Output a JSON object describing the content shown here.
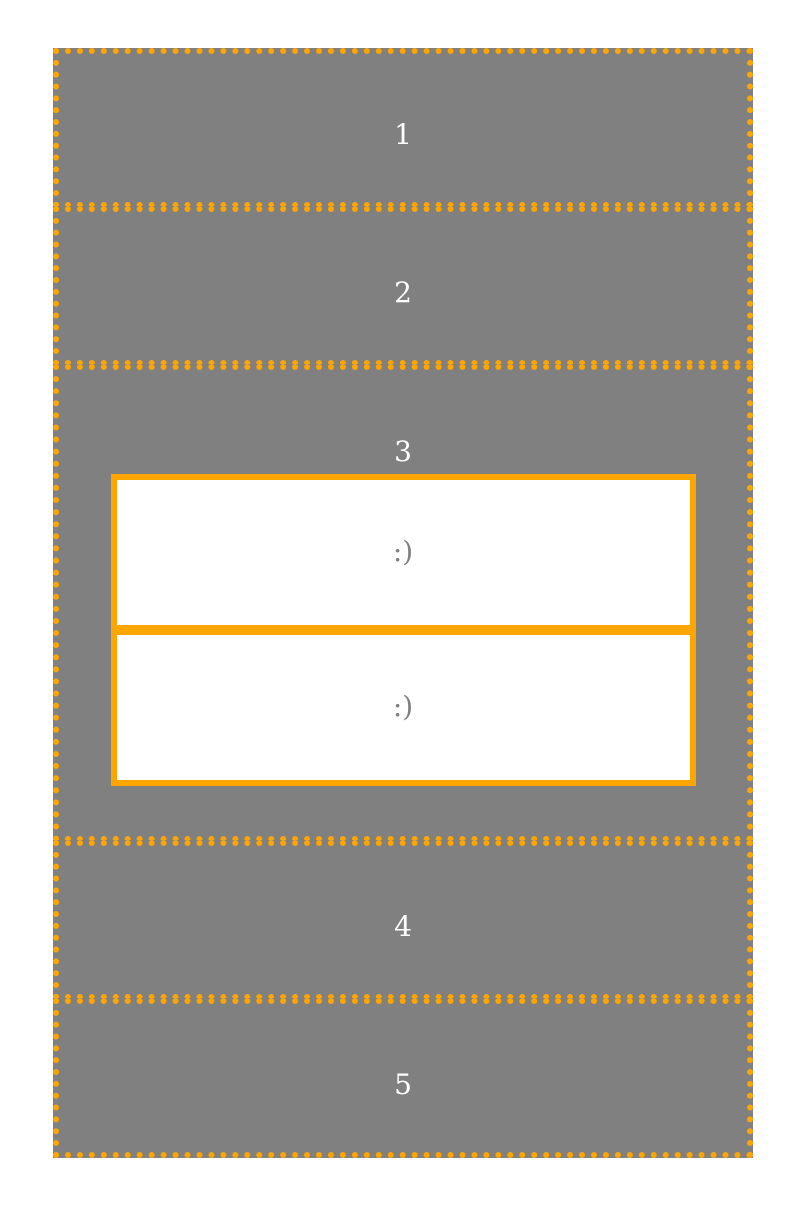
{
  "boxes": [
    {
      "label": "1"
    },
    {
      "label": "2"
    },
    {
      "label": "3",
      "children": [
        ":)",
        ":)"
      ]
    },
    {
      "label": "4"
    },
    {
      "label": "5"
    }
  ],
  "colors": {
    "box_fill": "#808080",
    "border": "#ffa500",
    "inner_fill": "#ffffff",
    "box_text": "#ffffff",
    "inner_text": "#808080"
  }
}
